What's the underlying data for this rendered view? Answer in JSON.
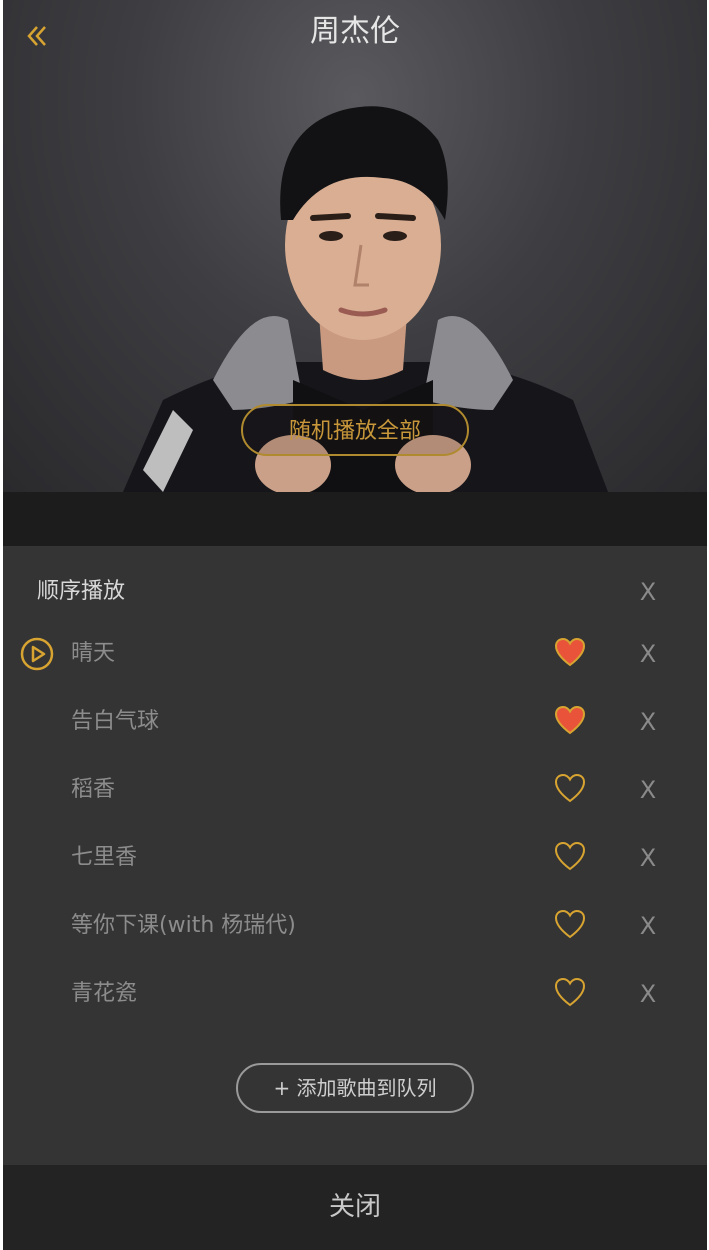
{
  "header": {
    "back_icon": "double-chevron-left-icon",
    "title": "周杰伦",
    "shuffle_label": "随机播放全部"
  },
  "queue": {
    "mode_label": "顺序播放",
    "clear_label": "X",
    "songs": [
      {
        "title": "晴天",
        "playing": true,
        "liked": true,
        "remove": "X"
      },
      {
        "title": "告白气球",
        "playing": false,
        "liked": true,
        "remove": "X"
      },
      {
        "title": "稻香",
        "playing": false,
        "liked": false,
        "remove": "X"
      },
      {
        "title": "七里香",
        "playing": false,
        "liked": false,
        "remove": "X"
      },
      {
        "title": "等你下课(with 杨瑞代)",
        "playing": false,
        "liked": false,
        "remove": "X"
      },
      {
        "title": "青花瓷",
        "playing": false,
        "liked": false,
        "remove": "X"
      }
    ],
    "add_label": "+ 添加歌曲到队列"
  },
  "footer": {
    "close_label": "关闭"
  },
  "colors": {
    "accent": "#d8a431",
    "heart_filled": "#e8533a",
    "panel": "#343434"
  }
}
